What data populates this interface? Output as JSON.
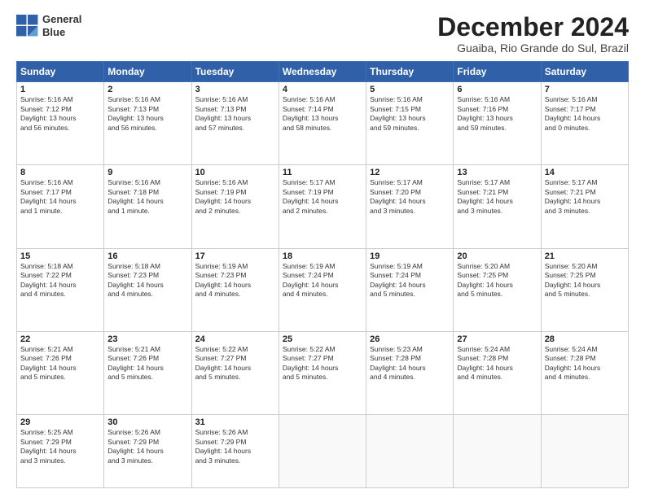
{
  "logo": {
    "line1": "General",
    "line2": "Blue"
  },
  "title": "December 2024",
  "subtitle": "Guaiba, Rio Grande do Sul, Brazil",
  "weekdays": [
    "Sunday",
    "Monday",
    "Tuesday",
    "Wednesday",
    "Thursday",
    "Friday",
    "Saturday"
  ],
  "weeks": [
    [
      {
        "day": "1",
        "info": "Sunrise: 5:16 AM\nSunset: 7:12 PM\nDaylight: 13 hours\nand 56 minutes."
      },
      {
        "day": "2",
        "info": "Sunrise: 5:16 AM\nSunset: 7:13 PM\nDaylight: 13 hours\nand 56 minutes."
      },
      {
        "day": "3",
        "info": "Sunrise: 5:16 AM\nSunset: 7:13 PM\nDaylight: 13 hours\nand 57 minutes."
      },
      {
        "day": "4",
        "info": "Sunrise: 5:16 AM\nSunset: 7:14 PM\nDaylight: 13 hours\nand 58 minutes."
      },
      {
        "day": "5",
        "info": "Sunrise: 5:16 AM\nSunset: 7:15 PM\nDaylight: 13 hours\nand 59 minutes."
      },
      {
        "day": "6",
        "info": "Sunrise: 5:16 AM\nSunset: 7:16 PM\nDaylight: 13 hours\nand 59 minutes."
      },
      {
        "day": "7",
        "info": "Sunrise: 5:16 AM\nSunset: 7:17 PM\nDaylight: 14 hours\nand 0 minutes."
      }
    ],
    [
      {
        "day": "8",
        "info": "Sunrise: 5:16 AM\nSunset: 7:17 PM\nDaylight: 14 hours\nand 1 minute."
      },
      {
        "day": "9",
        "info": "Sunrise: 5:16 AM\nSunset: 7:18 PM\nDaylight: 14 hours\nand 1 minute."
      },
      {
        "day": "10",
        "info": "Sunrise: 5:16 AM\nSunset: 7:19 PM\nDaylight: 14 hours\nand 2 minutes."
      },
      {
        "day": "11",
        "info": "Sunrise: 5:17 AM\nSunset: 7:19 PM\nDaylight: 14 hours\nand 2 minutes."
      },
      {
        "day": "12",
        "info": "Sunrise: 5:17 AM\nSunset: 7:20 PM\nDaylight: 14 hours\nand 3 minutes."
      },
      {
        "day": "13",
        "info": "Sunrise: 5:17 AM\nSunset: 7:21 PM\nDaylight: 14 hours\nand 3 minutes."
      },
      {
        "day": "14",
        "info": "Sunrise: 5:17 AM\nSunset: 7:21 PM\nDaylight: 14 hours\nand 3 minutes."
      }
    ],
    [
      {
        "day": "15",
        "info": "Sunrise: 5:18 AM\nSunset: 7:22 PM\nDaylight: 14 hours\nand 4 minutes."
      },
      {
        "day": "16",
        "info": "Sunrise: 5:18 AM\nSunset: 7:23 PM\nDaylight: 14 hours\nand 4 minutes."
      },
      {
        "day": "17",
        "info": "Sunrise: 5:19 AM\nSunset: 7:23 PM\nDaylight: 14 hours\nand 4 minutes."
      },
      {
        "day": "18",
        "info": "Sunrise: 5:19 AM\nSunset: 7:24 PM\nDaylight: 14 hours\nand 4 minutes."
      },
      {
        "day": "19",
        "info": "Sunrise: 5:19 AM\nSunset: 7:24 PM\nDaylight: 14 hours\nand 5 minutes."
      },
      {
        "day": "20",
        "info": "Sunrise: 5:20 AM\nSunset: 7:25 PM\nDaylight: 14 hours\nand 5 minutes."
      },
      {
        "day": "21",
        "info": "Sunrise: 5:20 AM\nSunset: 7:25 PM\nDaylight: 14 hours\nand 5 minutes."
      }
    ],
    [
      {
        "day": "22",
        "info": "Sunrise: 5:21 AM\nSunset: 7:26 PM\nDaylight: 14 hours\nand 5 minutes."
      },
      {
        "day": "23",
        "info": "Sunrise: 5:21 AM\nSunset: 7:26 PM\nDaylight: 14 hours\nand 5 minutes."
      },
      {
        "day": "24",
        "info": "Sunrise: 5:22 AM\nSunset: 7:27 PM\nDaylight: 14 hours\nand 5 minutes."
      },
      {
        "day": "25",
        "info": "Sunrise: 5:22 AM\nSunset: 7:27 PM\nDaylight: 14 hours\nand 5 minutes."
      },
      {
        "day": "26",
        "info": "Sunrise: 5:23 AM\nSunset: 7:28 PM\nDaylight: 14 hours\nand 4 minutes."
      },
      {
        "day": "27",
        "info": "Sunrise: 5:24 AM\nSunset: 7:28 PM\nDaylight: 14 hours\nand 4 minutes."
      },
      {
        "day": "28",
        "info": "Sunrise: 5:24 AM\nSunset: 7:28 PM\nDaylight: 14 hours\nand 4 minutes."
      }
    ],
    [
      {
        "day": "29",
        "info": "Sunrise: 5:25 AM\nSunset: 7:29 PM\nDaylight: 14 hours\nand 3 minutes."
      },
      {
        "day": "30",
        "info": "Sunrise: 5:26 AM\nSunset: 7:29 PM\nDaylight: 14 hours\nand 3 minutes."
      },
      {
        "day": "31",
        "info": "Sunrise: 5:26 AM\nSunset: 7:29 PM\nDaylight: 14 hours\nand 3 minutes."
      },
      null,
      null,
      null,
      null
    ]
  ]
}
